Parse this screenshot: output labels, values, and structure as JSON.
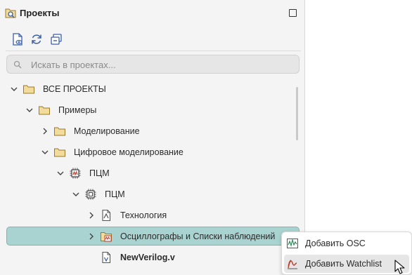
{
  "panel": {
    "title": "Проекты",
    "title_icon": "projects-search-icon",
    "maximize_icon": "maximize-icon"
  },
  "toolbar": {
    "buttons": [
      {
        "name": "view-file-icon"
      },
      {
        "name": "refresh-icon"
      },
      {
        "name": "collapse-all-icon"
      }
    ]
  },
  "search": {
    "placeholder": "Искать в проектах..."
  },
  "tree": [
    {
      "label": "ВСЕ ПРОЕКТЫ",
      "expanded": true,
      "icon": "folder-icon"
    },
    {
      "label": "Примеры",
      "expanded": true,
      "icon": "folder-icon"
    },
    {
      "label": "Моделирование",
      "expanded": false,
      "icon": "folder-icon"
    },
    {
      "label": "Цифровое моделирование",
      "expanded": true,
      "icon": "folder-icon"
    },
    {
      "label": "ПЦМ",
      "expanded": true,
      "icon": "chip-project-icon"
    },
    {
      "label": "ПЦМ",
      "expanded": true,
      "icon": "chip-icon"
    },
    {
      "label": "Технология",
      "expanded": false,
      "icon": "technology-icon"
    },
    {
      "label": "Осциллографы и Списки наблюдений",
      "expanded": false,
      "icon": "oscilloscope-folder-icon",
      "selected": true
    },
    {
      "label": "NewVerilog.v",
      "icon": "verilog-file-icon"
    }
  ],
  "context_menu": {
    "items": [
      {
        "label": "Добавить OSC",
        "icon": "oscilloscope-icon"
      },
      {
        "label": "Добавить Watchlist",
        "icon": "watchlist-icon",
        "hovered": true
      }
    ]
  },
  "colors": {
    "selected_bg": "#a9d3d0",
    "folder": "#e8c46a",
    "accent": "#c0392b"
  }
}
